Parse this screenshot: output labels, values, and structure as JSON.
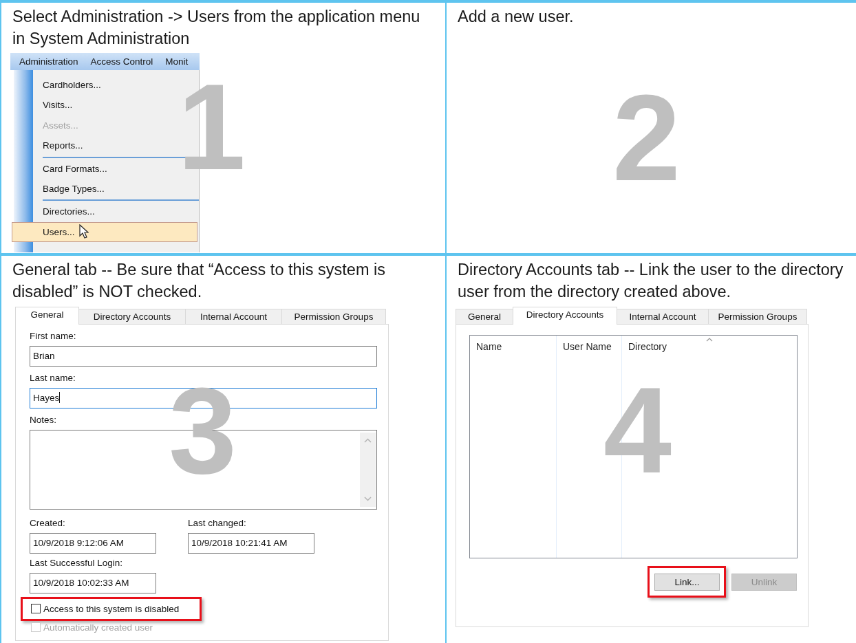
{
  "steps": [
    {
      "kind": "menu",
      "caption": "Select Administration -> Users from the application menu in System Administration",
      "number": "1",
      "menu": {
        "bar": [
          "Administration",
          "Access Control",
          "Monit"
        ],
        "items": [
          {
            "kind": "item",
            "label": "Cardholders...",
            "disabled": false,
            "selected": false
          },
          {
            "kind": "item",
            "label": "Visits...",
            "disabled": false,
            "selected": false
          },
          {
            "kind": "item",
            "label": "Assets...",
            "disabled": true,
            "selected": false
          },
          {
            "kind": "item",
            "label": "Reports...",
            "disabled": false,
            "selected": false
          },
          {
            "kind": "separator"
          },
          {
            "kind": "item",
            "label": "Card Formats...",
            "disabled": false,
            "selected": false
          },
          {
            "kind": "item",
            "label": "Badge Types...",
            "disabled": false,
            "selected": false
          },
          {
            "kind": "separator"
          },
          {
            "kind": "item",
            "label": "Directories...",
            "disabled": false,
            "selected": false
          },
          {
            "kind": "item",
            "label": "Users...",
            "disabled": false,
            "selected": true
          }
        ]
      }
    },
    {
      "kind": "blank",
      "caption": "Add a new user.",
      "number": "2"
    },
    {
      "kind": "general",
      "caption": "General tab -- Be sure that “Access to this system is disabled” is NOT checked.",
      "number": "3",
      "dialog": {
        "tabs": [
          {
            "label": "General",
            "selected": true
          },
          {
            "label": "Directory Accounts",
            "selected": false
          },
          {
            "label": "Internal Account",
            "selected": false
          },
          {
            "label": "Permission Groups",
            "selected": false
          }
        ],
        "fields": [
          {
            "label": "First name:",
            "value": "Brian",
            "focused": false
          },
          {
            "label": "Last name:",
            "value": "Hayes",
            "focused": true
          }
        ],
        "notes_label": "Notes:",
        "dates": [
          {
            "label": "Created:",
            "value": "10/9/2018 9:12:06 AM"
          },
          {
            "label": "Last changed:",
            "value": "10/9/2018 10:21:41 AM"
          },
          {
            "label": "Last Successful Login:",
            "value": "10/9/2018 10:02:33 AM"
          }
        ],
        "checkboxes": [
          {
            "label": "Access to this system is disabled",
            "checked": false,
            "disabled": false,
            "highlighted": true
          },
          {
            "label": "Automatically created user",
            "checked": false,
            "disabled": true,
            "highlighted": false
          }
        ]
      }
    },
    {
      "kind": "directory",
      "caption": "Directory Accounts tab -- Link the user to the directory user from the directory created above.",
      "number": "4",
      "dialog": {
        "tabs": [
          {
            "label": "General",
            "selected": false
          },
          {
            "label": "Directory Accounts",
            "selected": true
          },
          {
            "label": "Internal Account",
            "selected": false
          },
          {
            "label": "Permission Groups",
            "selected": false
          }
        ],
        "columns": [
          "Name",
          "User Name",
          "Directory"
        ],
        "buttons": [
          {
            "label": "Link...",
            "disabled": false,
            "highlighted": true
          },
          {
            "label": "Unlink",
            "disabled": true,
            "highlighted": false
          }
        ]
      }
    }
  ]
}
